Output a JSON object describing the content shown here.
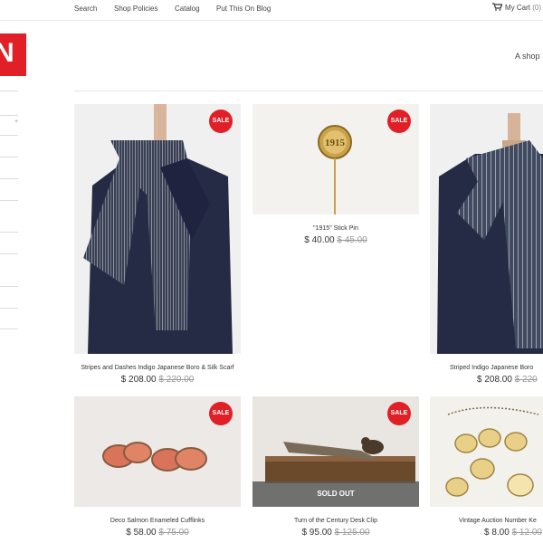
{
  "nav": {
    "items": [
      "Search",
      "Shop Policies",
      "Catalog",
      "Put This On Blog"
    ],
    "cart_label": "My Cart",
    "cart_count": "(0)"
  },
  "logo_text": "N",
  "tagline": "A shop",
  "sale_label": "SALE",
  "sold_out_label": "SOLD OUT",
  "products": [
    {
      "title": "Stripes and Dashes Indigo Japanese Boro & Silk Scarf",
      "price": "$ 208.00",
      "old_price": "$ 220.00"
    },
    {
      "title": "\"1915\" Stick Pin",
      "price": "$ 40.00",
      "old_price": "$ 45.00"
    },
    {
      "title": "Striped Indigo Japanese Boro",
      "price": "$ 208.00",
      "old_price": "$ 220"
    },
    {
      "title": "Deco Salmon Enameled Cufflinks",
      "price": "$ 58.00",
      "old_price": "$ 75.00"
    },
    {
      "title": "Turn of the Century Desk Clip",
      "price": "$ 95.00",
      "old_price": "$ 125.00"
    },
    {
      "title": "Vintage Auction Number Ke",
      "price": "$ 8.00",
      "old_price": "$ 12.00"
    }
  ],
  "colors": {
    "accent_red": "#e01f26",
    "navy": "#2b2f4a"
  }
}
